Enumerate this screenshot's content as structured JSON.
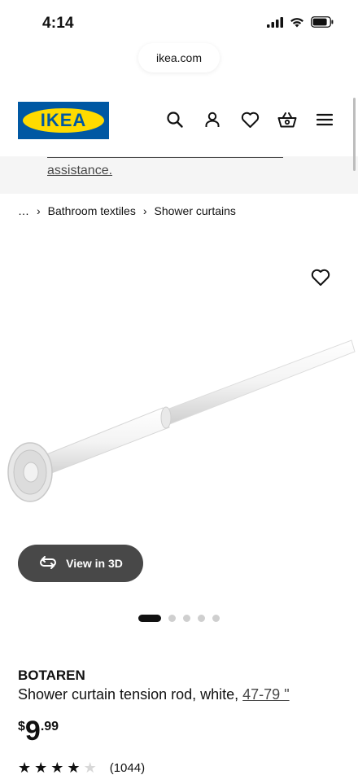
{
  "status_bar": {
    "time": "4:14",
    "icons": [
      "signal-icon",
      "wifi-icon",
      "battery-icon"
    ]
  },
  "browser": {
    "url": "ikea.com"
  },
  "header": {
    "logo_text": "IKEA",
    "brand_colors": {
      "blue": "#0058a3",
      "yellow": "#ffdb00"
    },
    "icons": [
      "search-icon",
      "account-icon",
      "heart-icon",
      "basket-icon",
      "menu-icon"
    ]
  },
  "banner": {
    "link_text": "assistance."
  },
  "breadcrumb": {
    "items": [
      "…",
      "Bathroom textiles",
      "Shower curtains"
    ]
  },
  "product": {
    "view_3d_label": "View in 3D",
    "carousel": {
      "total": 5,
      "active_index": 0
    },
    "name": "BOTAREN",
    "description": "Shower curtain tension rod, white, ",
    "size_link": "47-79 \"",
    "price": {
      "currency": "$",
      "integer": "9",
      "decimal": ".99"
    },
    "rating": {
      "stars": 4,
      "max": 5
    },
    "review_count": "(1044)"
  }
}
